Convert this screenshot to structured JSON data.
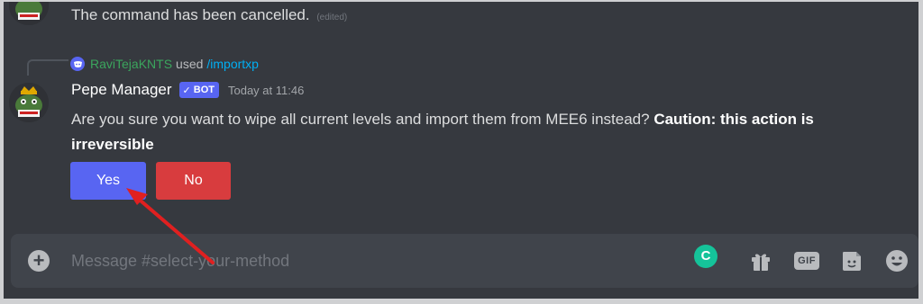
{
  "previous_message": {
    "text": "The command has been cancelled.",
    "edited_label": "(edited)"
  },
  "reply": {
    "username": "RaviTejaKNTS",
    "used_label": "used",
    "command": "/importxp"
  },
  "message": {
    "author": "Pepe Manager",
    "bot_tag": "BOT",
    "timestamp": "Today at 11:46",
    "text": "Are you sure you want to wipe all current levels and import them from MEE6 instead?",
    "warning": "Caution: this action is irreversible"
  },
  "buttons": {
    "yes_label": "Yes",
    "no_label": "No",
    "yes_color": "#5865f2",
    "no_color": "#d83c3e"
  },
  "composer": {
    "placeholder": "Message #select-your-method",
    "gif_label": "GIF",
    "grammarly_letter": "C",
    "icons": [
      "plus-circle-icon",
      "grammarly-icon",
      "gift-icon",
      "gif-icon",
      "sticker-icon",
      "emoji-icon"
    ]
  },
  "theme": {
    "background": "#36393f",
    "composer_bg": "#40444b",
    "accent": "#5865f2",
    "annotation_arrow": "#e02020"
  }
}
